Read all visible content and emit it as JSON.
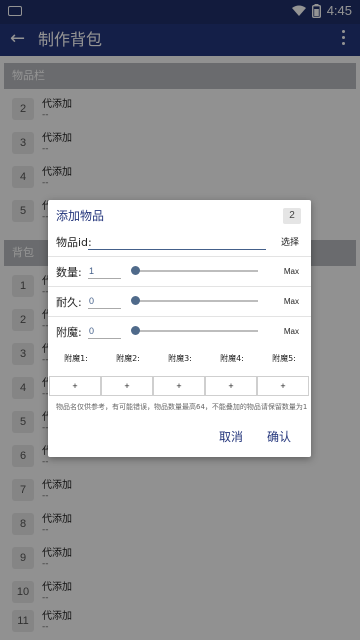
{
  "statusbar": {
    "time": "4:45",
    "icons": [
      "notification-icon",
      "wifi-icon",
      "battery-icon"
    ]
  },
  "appbar": {
    "title": "制作背包",
    "back_icon": "arrow-left-icon",
    "menu_icon": "more-vert-icon"
  },
  "sections": {
    "items_bar": "物品栏",
    "backpack": "背包"
  },
  "items_bar_rows": [
    {
      "index": "2",
      "name": "代添加",
      "sub": "--"
    },
    {
      "index": "3",
      "name": "代添加",
      "sub": "--"
    },
    {
      "index": "4",
      "name": "代添加",
      "sub": "--"
    },
    {
      "index": "5",
      "name": "代添加",
      "sub": "--"
    }
  ],
  "backpack_rows": [
    {
      "index": "1",
      "name": "代添加",
      "sub": "--"
    },
    {
      "index": "2",
      "name": "代添加",
      "sub": "--"
    },
    {
      "index": "3",
      "name": "代添加",
      "sub": "--"
    },
    {
      "index": "4",
      "name": "代添加",
      "sub": "--"
    },
    {
      "index": "5",
      "name": "代添加",
      "sub": "--"
    },
    {
      "index": "6",
      "name": "代添加",
      "sub": "--"
    },
    {
      "index": "7",
      "name": "代添加",
      "sub": "--"
    },
    {
      "index": "8",
      "name": "代添加",
      "sub": "--"
    },
    {
      "index": "9",
      "name": "代添加",
      "sub": "--"
    },
    {
      "index": "10",
      "name": "代添加",
      "sub": "--"
    },
    {
      "index": "11",
      "name": "代添加",
      "sub": "--"
    }
  ],
  "dialog": {
    "title": "添加物品",
    "count": "2",
    "id_label": "物品id:",
    "id_value": "",
    "select_label": "选择",
    "quantity": {
      "label": "数量:",
      "value": "1",
      "max_label": "Max",
      "slider_level": 0
    },
    "durability": {
      "label": "耐久:",
      "value": "0",
      "max_label": "Max",
      "slider_level": 0
    },
    "enchant": {
      "label": "附魔:",
      "value": "0",
      "max_label": "Max",
      "slider_level": 0
    },
    "enchant_slots": [
      {
        "label": "附魔1:",
        "button": "+"
      },
      {
        "label": "附魔2:",
        "button": "+"
      },
      {
        "label": "附魔3:",
        "button": "+"
      },
      {
        "label": "附魔4:",
        "button": "+"
      },
      {
        "label": "附魔5:",
        "button": "+"
      }
    ],
    "note": "物品名仅供参考，有可能错误，物品数量最高64，不能叠加的物品请保留数量为1",
    "cancel_label": "取消",
    "confirm_label": "确认"
  },
  "colors": {
    "primary": "#24367c",
    "statusbar": "#1f2f6a",
    "section_header": "#b7b9bd",
    "slider_thumb": "#4f6a8a"
  }
}
